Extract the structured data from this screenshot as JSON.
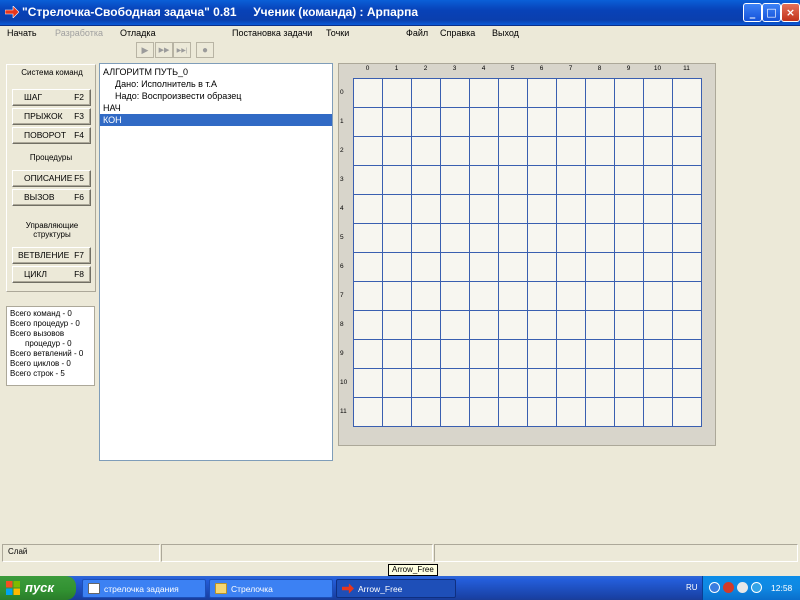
{
  "window": {
    "title": "\"Стрелочка-Свободная задача\" 0.81     Ученик (команда) : Арпарпа",
    "buttons": {
      "minimize": "_",
      "maximize": "□",
      "close": "×"
    }
  },
  "menu": {
    "items": [
      {
        "label": "Начать",
        "enabled": true
      },
      {
        "label": "Разработка",
        "enabled": false
      },
      {
        "label": "Отладка",
        "enabled": true
      },
      {
        "label": "Постановка задачи",
        "enabled": true
      },
      {
        "label": "Точки",
        "enabled": true
      },
      {
        "label": "Файл",
        "enabled": true
      },
      {
        "label": "Справка",
        "enabled": true
      },
      {
        "label": "Выход",
        "enabled": true
      }
    ]
  },
  "toolbar": {
    "buttons": [
      {
        "icon": "run-icon",
        "glyph": "▶"
      },
      {
        "icon": "fast-forward-icon",
        "glyph": "▶▶"
      },
      {
        "icon": "step-forward-icon",
        "glyph": "▶▶|"
      },
      {
        "icon": "stop-icon",
        "glyph": "●"
      }
    ]
  },
  "left_panel": {
    "section_commands": "Система команд",
    "commands": [
      {
        "label": "ШАГ",
        "key": "F2"
      },
      {
        "label": "ПРЫЖОК",
        "key": "F3"
      },
      {
        "label": "ПОВОРОТ",
        "key": "F4"
      }
    ],
    "section_procedures": "Процедуры",
    "procedures": [
      {
        "label": "ОПИСАНИЕ",
        "key": "F5"
      },
      {
        "label": "ВЫЗОВ",
        "key": "F6"
      }
    ],
    "section_structures": "Управляющие структуры",
    "structures": [
      {
        "label": "ВЕТВЛЕНИЕ",
        "key": "F7"
      },
      {
        "label": "ЦИКЛ",
        "key": "F8"
      }
    ]
  },
  "stats": [
    {
      "text": "Всего команд - 0",
      "indent": false
    },
    {
      "text": "Всего процедур - 0",
      "indent": false
    },
    {
      "text": "Всего вызовов",
      "indent": false
    },
    {
      "text": "процедур - 0",
      "indent": true
    },
    {
      "text": "Всего ветвлений - 0",
      "indent": false
    },
    {
      "text": "Всего циклов - 0",
      "indent": false
    },
    {
      "text": "Всего строк - 5",
      "indent": false
    }
  ],
  "editor": {
    "lines": [
      {
        "text": "АЛГОРИТМ ПУТЬ_0",
        "indent": false,
        "selected": false
      },
      {
        "text": "Дано: Исполнитель в т.А",
        "indent": true,
        "selected": false
      },
      {
        "text": "Надо: Воспроизвести образец",
        "indent": true,
        "selected": false
      },
      {
        "text": "НАЧ",
        "indent": false,
        "selected": false
      },
      {
        "text": "КОН",
        "indent": false,
        "selected": true
      }
    ]
  },
  "grid": {
    "columns": [
      "0",
      "1",
      "2",
      "3",
      "4",
      "5",
      "6",
      "7",
      "8",
      "9",
      "10",
      "11"
    ],
    "rows": [
      "0",
      "1",
      "2",
      "3",
      "4",
      "5",
      "6",
      "7",
      "8",
      "9",
      "10",
      "11"
    ],
    "line_color": "#3a5fb0"
  },
  "statusbar": {
    "text": "Слай"
  },
  "tooltip": "Arrow_Free",
  "taskbar": {
    "start_label": "пуск",
    "tasks": [
      {
        "label": "стрелочка задания",
        "icon": "document-icon",
        "active": false
      },
      {
        "label": "Стрелочка",
        "icon": "folder-icon",
        "active": false
      },
      {
        "label": "Arrow_Free",
        "icon": "arrow-app-icon",
        "active": true
      }
    ],
    "language": "RU",
    "clock": "12:58"
  }
}
